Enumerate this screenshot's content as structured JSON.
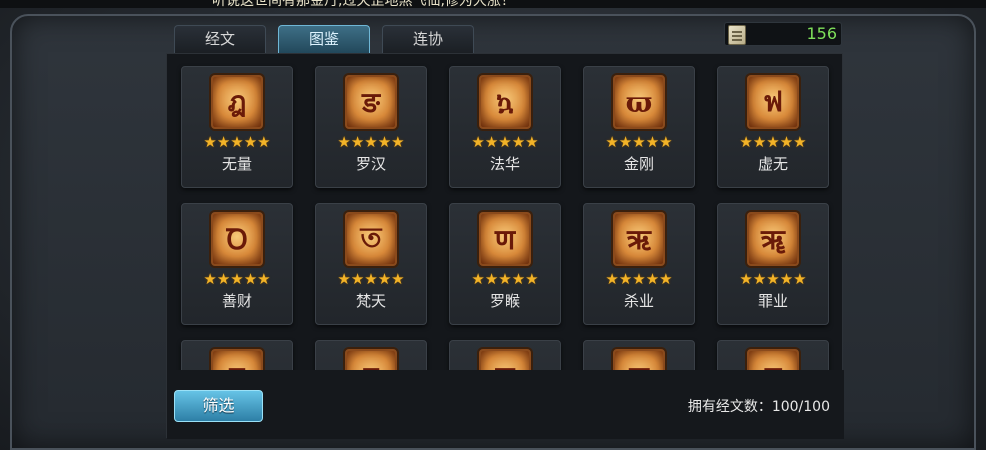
{
  "marquee_text": "听说这世间有那金丹,过天罡地煞飞仙,修为大涨！",
  "tabs": [
    {
      "label": "经文",
      "active": false
    },
    {
      "label": "图鉴",
      "active": true
    },
    {
      "label": "连协",
      "active": false
    }
  ],
  "currency": {
    "icon": "scroll-icon",
    "amount": "156"
  },
  "colors": {
    "accent": "#4aa3c8",
    "star": "#f2b328",
    "currency": "#7ee05a",
    "emblem": "#e39a48"
  },
  "cards": [
    {
      "name": "无量",
      "glyph": "ฎ",
      "stars": 5
    },
    {
      "name": "罗汉",
      "glyph": "ङ",
      "stars": 5
    },
    {
      "name": "法华",
      "glyph": "ኳ",
      "stars": 5
    },
    {
      "name": "金刚",
      "glyph": "ϖ",
      "stars": 5
    },
    {
      "name": "虚无",
      "glyph": "ฟ",
      "stars": 5
    },
    {
      "name": "善财",
      "glyph": "Ꝺ",
      "stars": 5
    },
    {
      "name": "梵天",
      "glyph": "ত",
      "stars": 5
    },
    {
      "name": "罗睺",
      "glyph": "ण",
      "stars": 5
    },
    {
      "name": "杀业",
      "glyph": "ऋ",
      "stars": 5
    },
    {
      "name": "罪业",
      "glyph": "ॠ",
      "stars": 5
    },
    {
      "name": "",
      "glyph": "ड",
      "stars": 0
    },
    {
      "name": "",
      "glyph": "द",
      "stars": 0
    },
    {
      "name": "",
      "glyph": "ल",
      "stars": 0
    },
    {
      "name": "",
      "glyph": "ऌ",
      "stars": 0
    },
    {
      "name": "",
      "glyph": "ठ",
      "stars": 0
    }
  ],
  "footer": {
    "filter_label": "筛选",
    "owned_label": "拥有经文数：",
    "owned_count": "100/100"
  }
}
